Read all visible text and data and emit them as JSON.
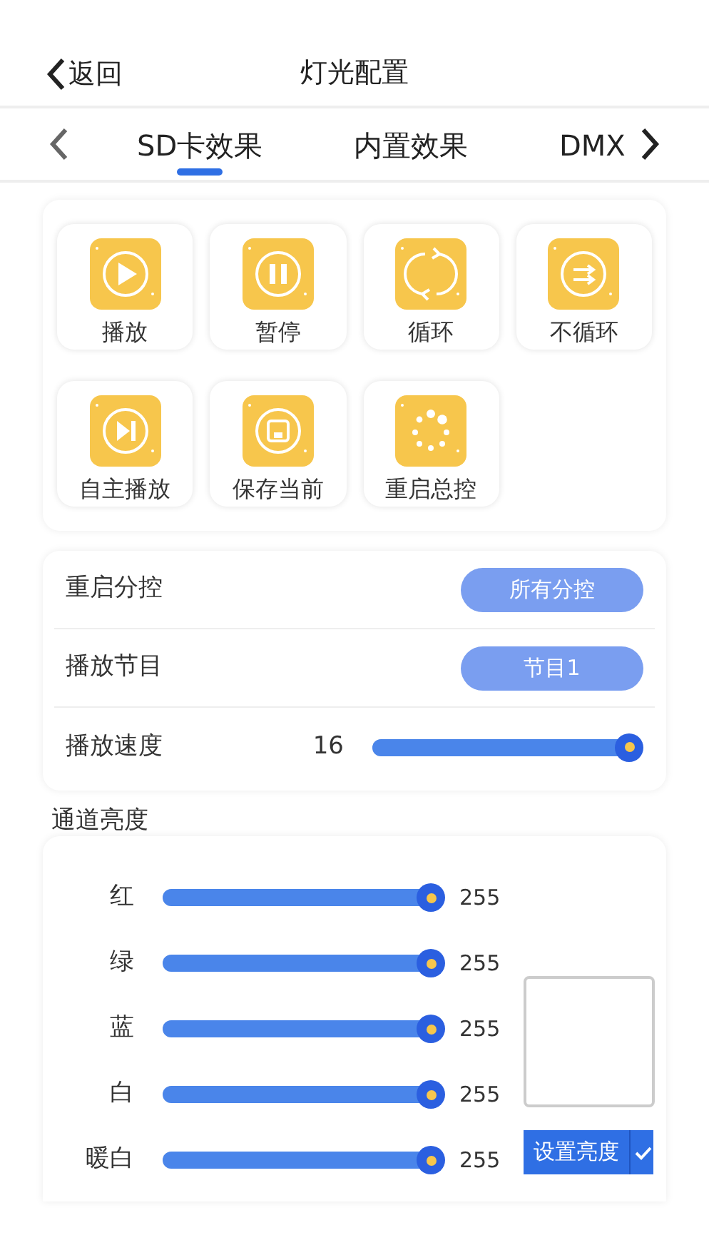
{
  "header": {
    "back": "返回",
    "title": "灯光配置"
  },
  "tabs": [
    {
      "label": "SD卡效果",
      "selected": true
    },
    {
      "label": "内置效果",
      "selected": false
    },
    {
      "label": "DMX",
      "selected": false
    }
  ],
  "actions": [
    {
      "kind": "play",
      "label": "播放"
    },
    {
      "kind": "pause",
      "label": "暂停"
    },
    {
      "kind": "loop",
      "label": "循环"
    },
    {
      "kind": "no-loop",
      "label": "不循环"
    },
    {
      "kind": "step",
      "label": "自主播放"
    },
    {
      "kind": "save",
      "label": "保存当前"
    },
    {
      "kind": "restart",
      "label": "重启总控"
    }
  ],
  "settings": [
    {
      "kind": "button",
      "label": "重启分控",
      "value": "所有分控"
    },
    {
      "kind": "button",
      "label": "播放节目",
      "value": "节目1"
    },
    {
      "kind": "slider",
      "label": "播放速度",
      "reading": "16",
      "level": 1
    }
  ],
  "channels": {
    "title": "通道亮度",
    "items": [
      {
        "name": "红",
        "level": 1,
        "reading": "255"
      },
      {
        "name": "绿",
        "level": 1,
        "reading": "255"
      },
      {
        "name": "蓝",
        "level": 1,
        "reading": "255"
      },
      {
        "name": "白",
        "level": 1,
        "reading": "255"
      },
      {
        "name": "暖白",
        "level": 1,
        "reading": "255"
      }
    ],
    "button": "设置亮度"
  }
}
